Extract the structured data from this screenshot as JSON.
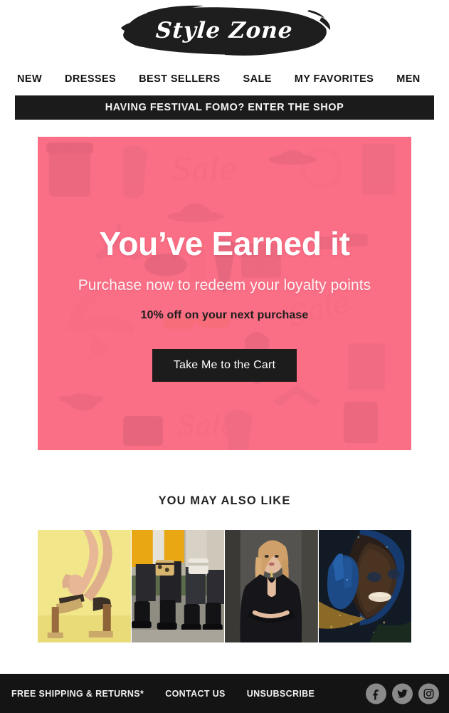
{
  "brand": {
    "logo_text": "Style Zone",
    "brush_color": "#1e1e1e",
    "logo_text_color": "#ffffff"
  },
  "nav": {
    "items": [
      {
        "label": "NEW"
      },
      {
        "label": "DRESSES"
      },
      {
        "label": "BEST SELLERS"
      },
      {
        "label": "SALE"
      },
      {
        "label": "MY FAVORITES"
      },
      {
        "label": "MEN"
      }
    ]
  },
  "promo_bar": {
    "text": "HAVING FESTIVAL FOMO? ENTER THE SHOP",
    "background": "#1b1b1b",
    "text_color": "#f4f4f4"
  },
  "hero": {
    "title": "You’ve Earned it",
    "subtitle": "Purchase now to redeem your loyalty points",
    "offer": "10% off on your next purchase",
    "cta_label": "Take Me to the Cart",
    "background_color": "#fa6f86",
    "cta_background": "#1c1c1c",
    "cta_text_color": "#ffffff",
    "pattern_motifs": [
      "dress",
      "hat",
      "tie",
      "sunglasses",
      "lipstick",
      "high-heel",
      "hanger",
      "pants",
      "handbag",
      "SALE"
    ]
  },
  "recommendations": {
    "title": "YOU MAY ALSO LIKE",
    "items": [
      {
        "alt": "woman wearing gold platform heels on yellow background"
      },
      {
        "alt": "two women in boots with leopard and white handbags"
      },
      {
        "alt": "blonde woman in black dress with arms crossed"
      },
      {
        "alt": "portrait with blue and gold glitter makeup"
      }
    ]
  },
  "footer": {
    "background": "#141414",
    "links": [
      {
        "label": "FREE SHIPPING & RETURNS*"
      },
      {
        "label": "CONTACT US"
      },
      {
        "label": "UNSUBSCRIBE"
      }
    ],
    "social": [
      {
        "name": "facebook",
        "glyph": "f"
      },
      {
        "name": "twitter",
        "glyph": "bird"
      },
      {
        "name": "instagram",
        "glyph": "camera"
      }
    ],
    "social_circle_color": "#8a8a8a"
  }
}
